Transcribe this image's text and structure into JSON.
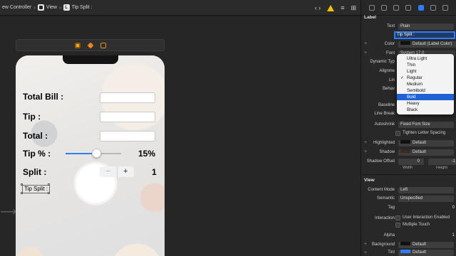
{
  "breadcrumb": {
    "items": [
      {
        "label": "ew Controller"
      },
      {
        "label": "View"
      },
      {
        "label": "Tip Split :"
      }
    ]
  },
  "phone": {
    "bill_label": "Total Bill :",
    "tip_label": "Tip :",
    "total_label": "Total :",
    "tip_pct_label": "Tip % :",
    "tip_pct_value": "15%",
    "tip_pct_slider_level": 0.55,
    "split_label": "Split :",
    "split_value": "1",
    "stepper_minus": "−",
    "stepper_plus": "+",
    "selected_label_text": "Tip Split :"
  },
  "inspector": {
    "label_section": "Label",
    "text_label": "Text",
    "text_mode": "Plain",
    "text_value": "Tip Split :",
    "color_label": "Color",
    "color_value": "Default (Label Color)",
    "font_label": "Font",
    "font_value": "System 17.0",
    "dynamic_type_label": "Dynamic Typ",
    "alignment_label": "Alignme",
    "lines_label": "Lin",
    "behavior_label": "Behav",
    "baseline_label": "Baseline",
    "line_break_label": "Line Break",
    "autoshrink_label": "Autoshrink",
    "autoshrink_value": "Fixed Font Size",
    "tighten_label": "Tighten Letter Spacing",
    "highlighted_label": "Highlighted",
    "highlighted_value": "Default",
    "shadow_label": "Shadow",
    "shadow_value": "Default",
    "shadow_offset_label": "Shadow Offset",
    "shadow_w": "0",
    "shadow_h": "-1",
    "width_label": "Width",
    "height_label": "Height",
    "view_section": "View",
    "content_mode_label": "Content Mode",
    "content_mode_value": "Left",
    "semantic_label": "Semantic",
    "semantic_value": "Unspecified",
    "tag_label": "Tag",
    "tag_value": "0",
    "interaction_label": "Interaction",
    "user_interaction_label": "User Interaction Enabled",
    "multiple_touch_label": "Multiple Touch",
    "alpha_label": "Alpha",
    "alpha_value": "1",
    "background_label": "Background",
    "background_value": "Default",
    "tint_label": "Tint",
    "tint_value": "Default"
  },
  "font_weight_menu": {
    "items": [
      "Ultra Light",
      "Thin",
      "Light",
      "Regular",
      "Medium",
      "Semibold",
      "Bold",
      "Heavy",
      "Black"
    ],
    "checked_index": 3,
    "highlighted_index": 6
  },
  "colors": {
    "accent": "#2f7cf6",
    "warning": "#f2c200",
    "menu_highlight": "#1f62d6"
  }
}
